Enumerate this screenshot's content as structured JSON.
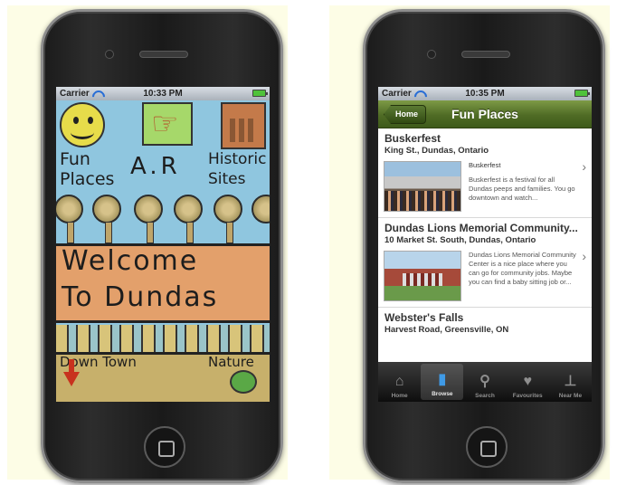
{
  "left_phone": {
    "status": {
      "carrier": "Carrier",
      "time": "10:33 PM"
    },
    "drawing": {
      "fun_places": "Fun Places",
      "ar": "A.R",
      "historic_sites": "Historic Sites",
      "welcome": "Welcome",
      "to_dundas": "To Dundas",
      "down_town": "Down Town",
      "nature": "Nature"
    }
  },
  "right_phone": {
    "status": {
      "carrier": "Carrier",
      "time": "10:35 PM"
    },
    "navbar": {
      "back": "Home",
      "title": "Fun Places"
    },
    "items": [
      {
        "title": "Buskerfest",
        "address": "King St., Dundas, Ontario",
        "subtitle": "Buskerfest",
        "description": "Buskerfest is a festival for all Dundas peeps and families. You go downtown and watch..."
      },
      {
        "title": "Dundas Lions Memorial Community...",
        "address": "10 Market St. South, Dundas, Ontario",
        "subtitle": "",
        "description": "Dundas Lions Memorial Community Center is a nice place where you can go for community jobs. Maybe you can find a baby sitting job or..."
      },
      {
        "title": "Webster's Falls",
        "address": "Harvest Road, Greensville, ON"
      }
    ],
    "tabs": [
      {
        "label": "Home",
        "icon": "house-icon"
      },
      {
        "label": "Browse",
        "icon": "book-icon",
        "active": true
      },
      {
        "label": "Search",
        "icon": "search-icon"
      },
      {
        "label": "Favourites",
        "icon": "heart-icon"
      },
      {
        "label": "Near Me",
        "icon": "signpost-icon"
      }
    ]
  }
}
